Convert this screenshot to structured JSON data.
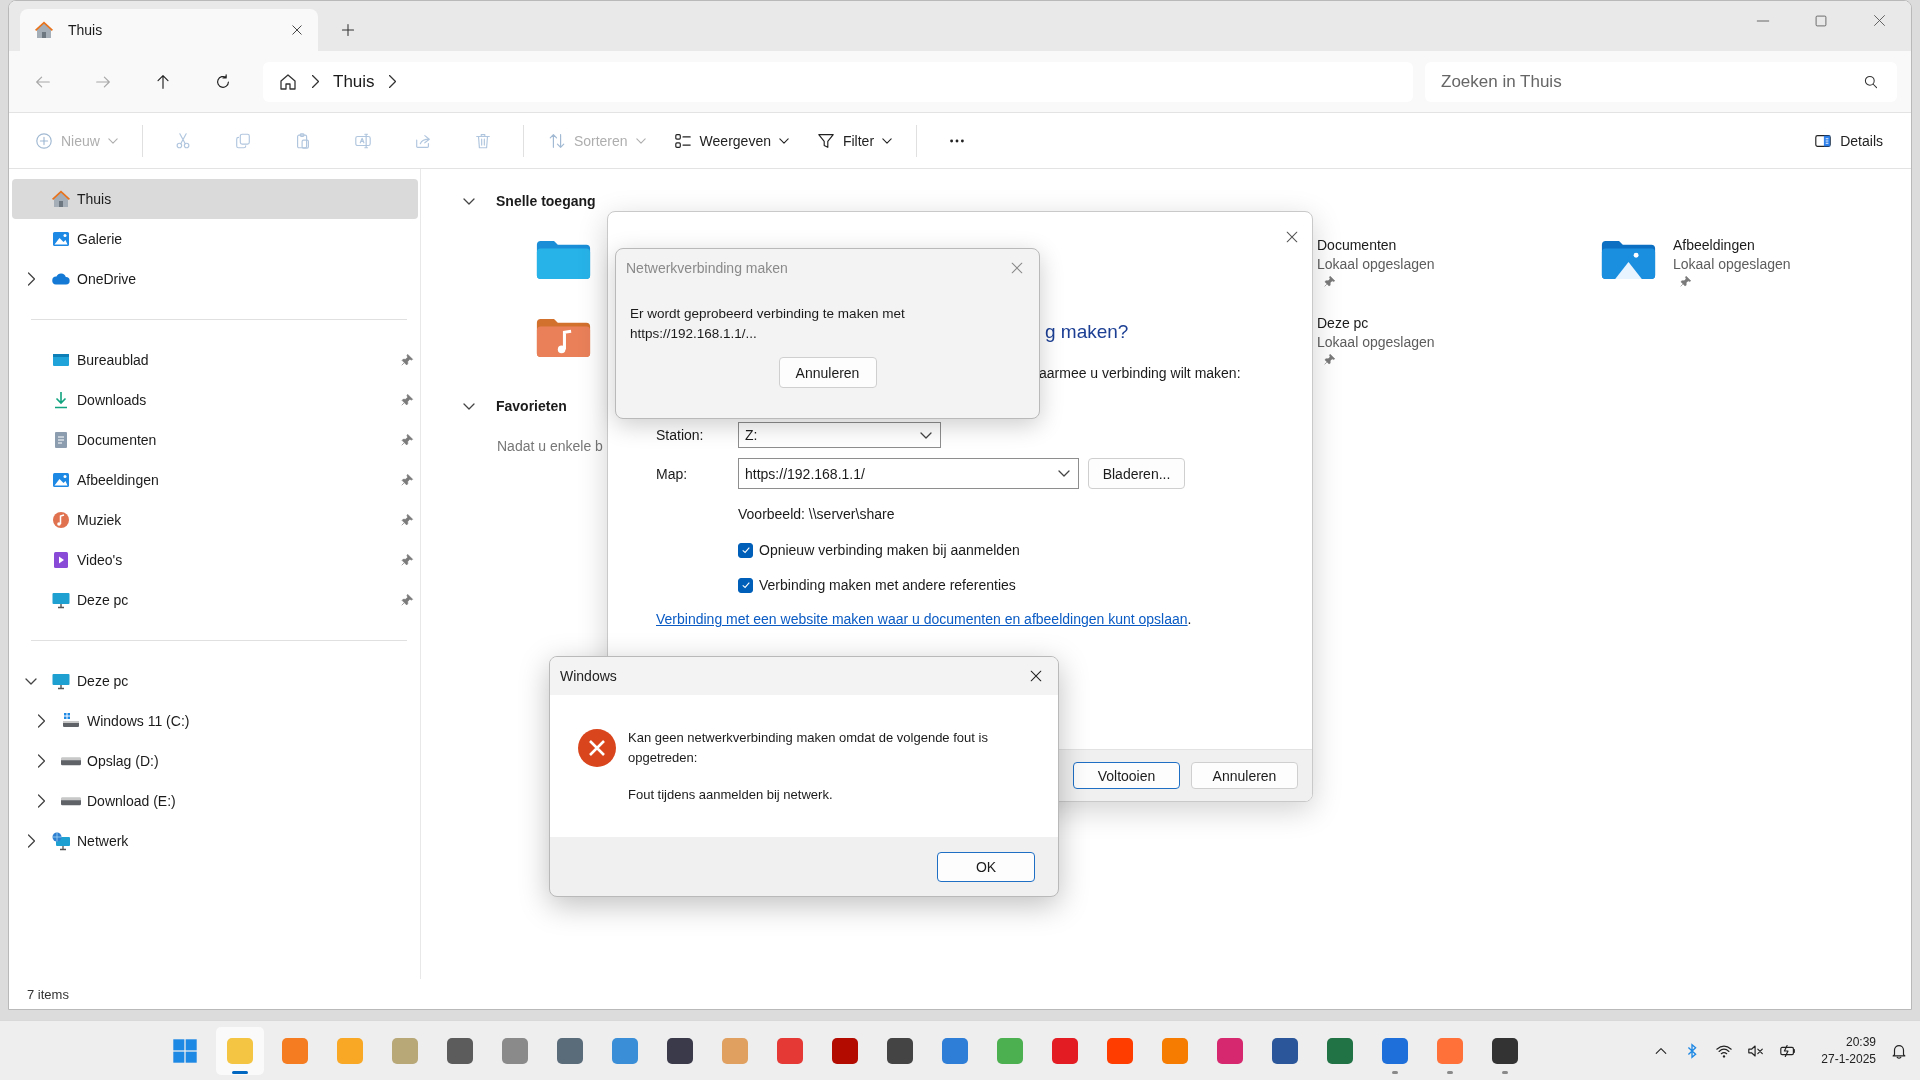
{
  "window": {
    "tabs": [
      {
        "title": "Thuis",
        "selected": true
      }
    ]
  },
  "navigation": {
    "buttons": [
      {
        "kind": "back",
        "disabled": true
      },
      {
        "kind": "forward",
        "disabled": true
      },
      {
        "kind": "up",
        "disabled": false
      },
      {
        "kind": "refresh",
        "disabled": false
      }
    ],
    "breadcrumb": [
      "Thuis"
    ],
    "search": {
      "placeholder": "Zoeken in Thuis"
    }
  },
  "toolbar": {
    "items": [
      {
        "kind": "new",
        "label": "Nieuw",
        "disabled": true,
        "dropdown": true
      },
      {
        "kind": "separator"
      },
      {
        "kind": "cut",
        "disabled": true
      },
      {
        "kind": "copy",
        "disabled": true
      },
      {
        "kind": "paste",
        "disabled": true
      },
      {
        "kind": "rename",
        "disabled": true
      },
      {
        "kind": "share",
        "disabled": true
      },
      {
        "kind": "delete",
        "disabled": true
      },
      {
        "kind": "separator"
      },
      {
        "kind": "sort",
        "label": "Sorteren",
        "disabled": true,
        "dropdown": true
      },
      {
        "kind": "view",
        "label": "Weergeven",
        "disabled": false,
        "dropdown": true
      },
      {
        "kind": "filter",
        "label": "Filter",
        "disabled": false,
        "dropdown": true
      },
      {
        "kind": "separator"
      },
      {
        "kind": "more",
        "disabled": false
      }
    ],
    "details": {
      "label": "Details"
    }
  },
  "sidebar": {
    "groups": [
      {
        "items": [
          {
            "kind": "home",
            "label": "Thuis",
            "selected": true
          },
          {
            "kind": "gallery",
            "label": "Galerie",
            "selected": false
          },
          {
            "kind": "cloud",
            "label": "OneDrive",
            "selected": false,
            "expanded": false
          }
        ]
      },
      {
        "items": [
          {
            "kind": "desktop",
            "label": "Bureaublad",
            "selected": false,
            "pinned": true
          },
          {
            "kind": "download",
            "label": "Downloads",
            "selected": false,
            "pinned": true
          },
          {
            "kind": "document",
            "label": "Documenten",
            "selected": false,
            "pinned": true
          },
          {
            "kind": "pictures",
            "label": "Afbeeldingen",
            "selected": false,
            "pinned": true
          },
          {
            "kind": "music",
            "label": "Muziek",
            "selected": false,
            "pinned": true
          },
          {
            "kind": "video",
            "label": "Video's",
            "selected": false,
            "pinned": true
          },
          {
            "kind": "pc",
            "label": "Deze pc",
            "selected": false,
            "pinned": true
          }
        ]
      },
      {
        "items": [
          {
            "kind": "pc",
            "label": "Deze pc",
            "selected": false,
            "expanded": true,
            "children": [
              {
                "kind": "windrive",
                "label": "Windows 11 (C:)",
                "selected": false,
                "expanded": false
              },
              {
                "kind": "drive",
                "label": "Opslag (D:)",
                "selected": false,
                "expanded": false
              },
              {
                "kind": "drive",
                "label": "Download (E:)",
                "selected": false,
                "expanded": false
              }
            ]
          },
          {
            "kind": "network",
            "label": "Netwerk",
            "selected": false,
            "expanded": false
          }
        ]
      }
    ]
  },
  "quick_access": {
    "title": "Snelle toegang",
    "expanded": true,
    "tiles": [
      {
        "kind": "desktop"
      },
      {
        "title": "Documenten",
        "subtitle": "Lokaal opgeslagen",
        "pinned": true
      },
      {
        "kind": "pictures",
        "title": "Afbeeldingen",
        "subtitle": "Lokaal opgeslagen",
        "pinned": true
      },
      {
        "kind": "music"
      },
      {
        "title": "Deze pc",
        "subtitle": "Lokaal opgeslagen",
        "pinned": true
      }
    ]
  },
  "favorites": {
    "title": "Favorieten",
    "expanded": true,
    "text": "Nadat u enkele b"
  },
  "status_bar": "7 items",
  "wizard": {
    "heading": "g maken?",
    "instruction": "aarmee u verbinding wilt maken:",
    "fields": [
      {
        "label": "Station:",
        "value": "Z:"
      },
      {
        "label": "Map:",
        "value": "https://192.168.1.1/",
        "button": "Bladeren..."
      }
    ],
    "example": "Voorbeeld: \\\\server\\share",
    "options": [
      {
        "label": "Opnieuw verbinding maken bij aanmelden",
        "checked": true
      },
      {
        "label": "Verbinding maken met andere referenties",
        "checked": true
      }
    ],
    "link": "Verbinding met een website maken waar u documenten en afbeeldingen kunt opslaan",
    "link_suffix": ".",
    "buttons": [
      {
        "label": "Voltooien",
        "default": true
      },
      {
        "label": "Annuleren",
        "default": false
      }
    ]
  },
  "progress_dialog": {
    "title": "Netwerkverbinding maken",
    "message": "Er wordt geprobeerd verbinding te maken met https://192.168.1.1/...",
    "button": "Annuleren"
  },
  "error_dialog": {
    "title": "Windows",
    "message": "Kan geen netwerkverbinding maken omdat de volgende fout is opgetreden:",
    "detail": "Fout tijdens aanmelden bij netwerk.",
    "button": "OK"
  },
  "taskbar": {
    "apps": [
      {
        "color": "#f4c542",
        "running": true,
        "active": true
      },
      {
        "color": "#f57c20",
        "running": false,
        "active": false
      },
      {
        "color": "#f9a825",
        "running": false,
        "active": false
      },
      {
        "color": "#b8a878",
        "running": false,
        "active": false
      },
      {
        "color": "#5c5c5c",
        "running": false,
        "active": false
      },
      {
        "color": "#8a8a8a",
        "running": false,
        "active": false
      },
      {
        "color": "#5a6b7a",
        "running": false,
        "active": false
      },
      {
        "color": "#3a8ed8",
        "running": false,
        "active": false
      },
      {
        "color": "#3a3a4a",
        "running": false,
        "active": false
      },
      {
        "color": "#e0a060",
        "running": false,
        "active": false
      },
      {
        "color": "#e53935",
        "running": false,
        "active": false
      },
      {
        "color": "#b30b00",
        "running": false,
        "active": false
      },
      {
        "color": "#444444",
        "running": false,
        "active": false
      },
      {
        "color": "#2e7dd7",
        "running": false,
        "active": false
      },
      {
        "color": "#4caf50",
        "running": false,
        "active": false
      },
      {
        "color": "#e31c23",
        "running": false,
        "active": false
      },
      {
        "color": "#ff3d00",
        "running": false,
        "active": false
      },
      {
        "color": "#f57c00",
        "running": false,
        "active": false
      },
      {
        "color": "#d6286e",
        "running": false,
        "active": false
      },
      {
        "color": "#2b579a",
        "running": false,
        "active": false
      },
      {
        "color": "#217346",
        "running": false,
        "active": false
      },
      {
        "color": "#1e6fd9",
        "running": true,
        "active": false
      },
      {
        "color": "#ff7139",
        "running": true,
        "active": false
      },
      {
        "color": "#333333",
        "running": true,
        "active": false
      }
    ],
    "time": "20:39",
    "date": "27-1-2025"
  }
}
